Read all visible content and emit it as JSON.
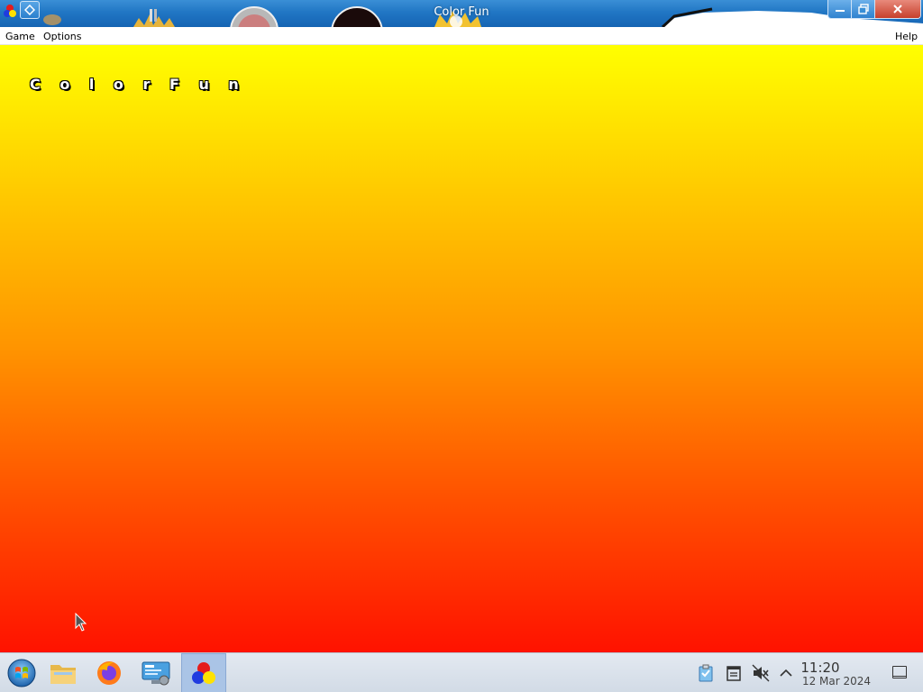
{
  "window": {
    "title": "Color Fun",
    "minimize_label": "—",
    "maximize_label": "❐",
    "close_label": "✕"
  },
  "menu": {
    "game": "Game",
    "options": "Options",
    "help": "Help"
  },
  "game": {
    "title_text": "C o l o r  F u n",
    "gradient_top": "#ffff00",
    "gradient_bottom": "#ff1200"
  },
  "taskbar": {
    "pinned_apps": [
      "start-menu",
      "file-manager",
      "firefox",
      "system-settings",
      "color-fun"
    ],
    "active_app": "Color Fun",
    "clock_time": "11:20",
    "clock_date": "12 Mar 2024"
  },
  "colors": {
    "titlebar": "#2176c4",
    "close_button": "#c7402c",
    "taskbar": "#d9e1ea"
  }
}
